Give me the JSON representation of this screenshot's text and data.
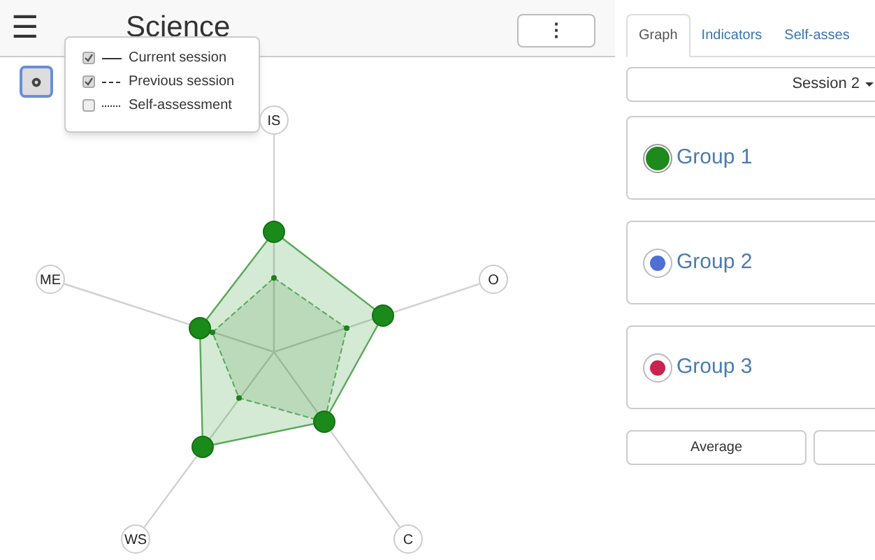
{
  "header": {
    "menu_icon": "☰",
    "title": "Science",
    "more_button": "⋮"
  },
  "legend_popup": {
    "items": [
      {
        "label": "Current session",
        "checked": true,
        "kind": "solid"
      },
      {
        "label": "Previous session",
        "checked": true,
        "kind": "dashed"
      },
      {
        "label": "Self-assessment",
        "checked": false,
        "kind": "dotted"
      }
    ]
  },
  "radar": {
    "axes": [
      "IS",
      "O",
      "C",
      "WS",
      "ME"
    ]
  },
  "tabs": [
    {
      "label": "Graph",
      "selected": true
    },
    {
      "label": "Indicators",
      "selected": false
    },
    {
      "label": "Self-asses",
      "selected": false
    }
  ],
  "session_dropdown": "Session 2",
  "groups": [
    {
      "name": "Group 1",
      "color": "#1e8a1e",
      "kind": "filled"
    },
    {
      "name": "Group 2",
      "color": "#4f6fd6",
      "kind": "ring"
    },
    {
      "name": "Group 3",
      "color": "#c8244f",
      "kind": "ring"
    }
  ],
  "buttons": [
    "Average"
  ]
}
